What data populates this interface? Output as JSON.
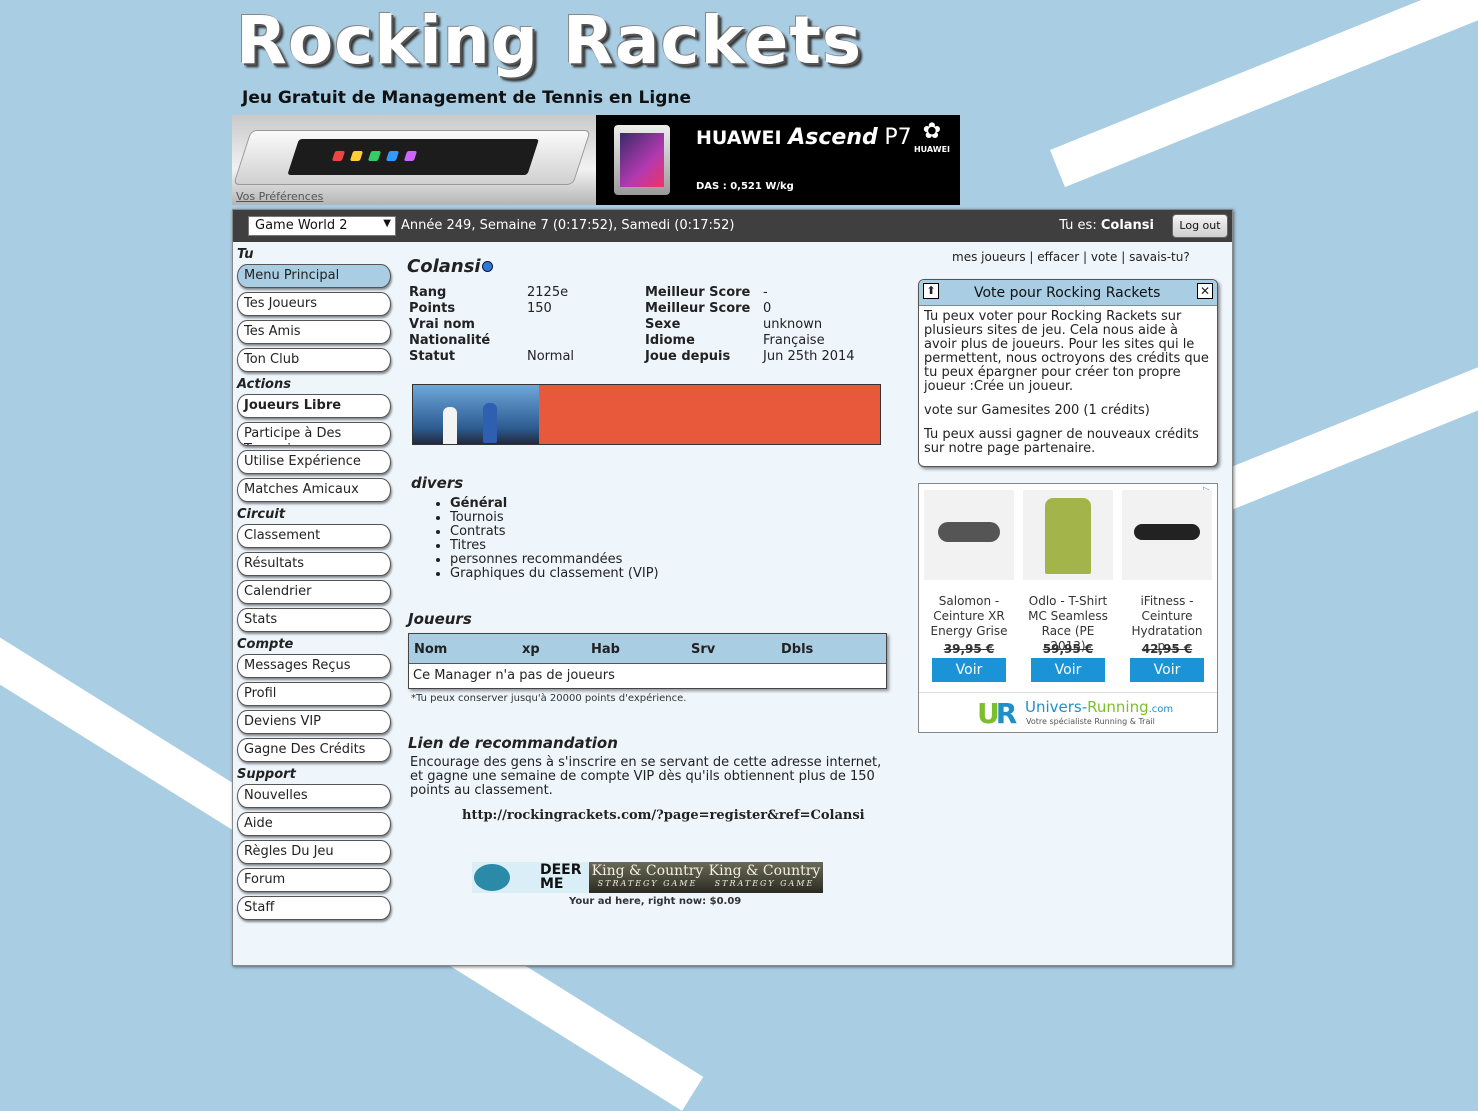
{
  "header": {
    "title": "Rocking Rackets",
    "tagline": "Jeu Gratuit de Management de Tennis en Ligne"
  },
  "top_ad": {
    "preferences_link": "Vos Préférences",
    "brand": "HUAWEI",
    "model_prefix": "Ascend",
    "model": "P7",
    "das": "DAS : 0,521 W/kg",
    "logo_text": "HUAWEI"
  },
  "topbar": {
    "world": "Game World 2",
    "game_date": "Année 249, Semaine 7 (0:17:52), Samedi (0:17:52)",
    "you_are_label": "Tu es:",
    "username": "Colansi",
    "logout": "Log out"
  },
  "sidebar": {
    "sections": [
      {
        "title": "Tu",
        "items": [
          {
            "label": "Menu Principal",
            "active": true
          },
          {
            "label": "Tes Joueurs"
          },
          {
            "label": "Tes Amis"
          },
          {
            "label": "Ton Club"
          }
        ]
      },
      {
        "title": "Actions",
        "items": [
          {
            "label": "Joueurs Libre",
            "bold": true
          },
          {
            "label": "Participe à Des Tournois"
          },
          {
            "label": "Utilise Expérience"
          },
          {
            "label": "Matches Amicaux"
          }
        ]
      },
      {
        "title": "Circuit",
        "items": [
          {
            "label": "Classement"
          },
          {
            "label": "Résultats"
          },
          {
            "label": "Calendrier"
          },
          {
            "label": "Stats"
          }
        ]
      },
      {
        "title": "Compte",
        "items": [
          {
            "label": "Messages Reçus"
          },
          {
            "label": "Profil"
          },
          {
            "label": "Deviens VIP"
          },
          {
            "label": "Gagne Des Crédits"
          }
        ]
      },
      {
        "title": "Support",
        "items": [
          {
            "label": "Nouvelles"
          },
          {
            "label": "Aide"
          },
          {
            "label": "Règles Du Jeu"
          },
          {
            "label": "Forum"
          },
          {
            "label": "Staff"
          }
        ]
      }
    ]
  },
  "profile": {
    "name": "Colansi",
    "rows": [
      {
        "k1": "Rang",
        "v1": "2125e",
        "k2": "Meilleur Score",
        "v2": "-"
      },
      {
        "k1": "Points",
        "v1": "150",
        "k2": "Meilleur Score",
        "v2": "0"
      },
      {
        "k1": "Vrai nom",
        "v1": "",
        "k2": "Sexe",
        "v2": "unknown"
      },
      {
        "k1": "Nationalité",
        "v1": "",
        "k2": "Idiome",
        "v2": "Française"
      },
      {
        "k1": "Statut",
        "v1": "Normal",
        "k2": "Joue depuis",
        "v2": "Jun 25th 2014"
      }
    ]
  },
  "divers": {
    "title": "divers",
    "items": [
      "Général",
      "Tournois",
      "Contrats",
      "Titres",
      "personnes recommandées",
      "Graphiques du classement (VIP)"
    ]
  },
  "players": {
    "title": "Joueurs",
    "columns": [
      "Nom",
      "xp",
      "Hab",
      "Srv",
      "Dbls"
    ],
    "empty_message": "Ce Manager n'a pas de joueurs",
    "note": "*Tu peux conserver jusqu'à 20000 points d'expérience."
  },
  "referral": {
    "title": "Lien de recommandation",
    "text": "Encourage des gens à s'inscrire en se servant de cette adresse internet, et gagne une semaine de compte VIP dès qu'ils obtiennent plus de 150 points au classement.",
    "link": "http://rockingrackets.com/?page=register&ref=Colansi"
  },
  "small_ad": {
    "deer1": "DEER",
    "deer2": "ME",
    "kc_title": "King & Country",
    "kc_sub": "STRATEGY GAME",
    "caption": "Your ad here, right now: $0.09"
  },
  "top_links": {
    "items": [
      "mes joueurs",
      "effacer",
      "vote",
      "savais-tu?"
    ]
  },
  "vote": {
    "title": "Vote pour Rocking Rackets",
    "p1": "Tu peux voter pour Rocking Rackets sur plusieurs sites de jeu. Cela nous aide à avoir plus de joueurs. Pour les sites qui le permettent, nous octroyons des crédits que tu peux épargner pour créer ton propre joueur :Crée un joueur.",
    "p2": "vote sur Gamesites 200 (1 crédits)",
    "p3": "Tu peux aussi gagner de nouveaux crédits sur notre page partenaire."
  },
  "product_ad": {
    "products": [
      {
        "name": "Salomon - Ceinture XR Energy Grise",
        "price": "39,95 €",
        "button": "Voir"
      },
      {
        "name": "Odlo - T-Shirt MC Seamless Race (PE 2013)",
        "price": "59,95 €",
        "button": "Voir"
      },
      {
        "name": "iFitness - Ceinture Hydratation p...",
        "price": "42,95 €",
        "button": "Voir"
      }
    ],
    "brand_mark_u": "U",
    "brand_mark_r": "R",
    "brand_name_a": "Univers-",
    "brand_name_b": "Running",
    "brand_name_c": ".com",
    "brand_sub": "Votre spécialiste Running & Trail"
  }
}
